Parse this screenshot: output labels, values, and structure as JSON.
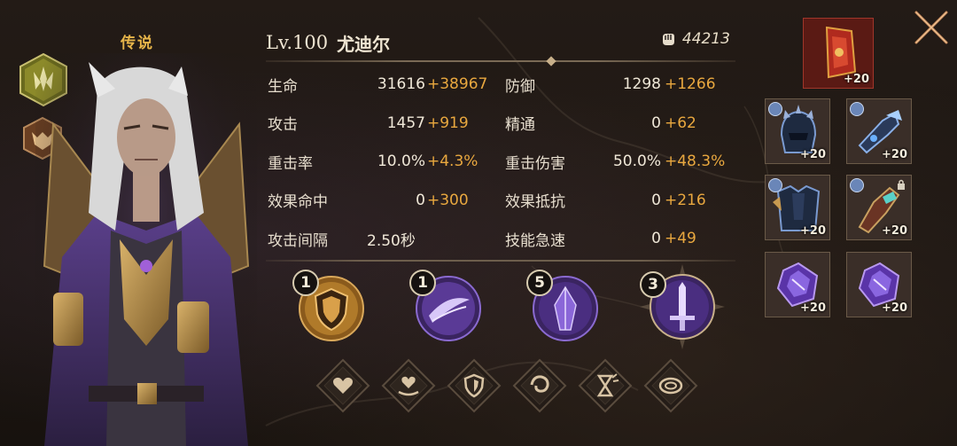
{
  "hero": {
    "rarity": "传说",
    "level": "Lv.100",
    "name": "尤迪尔",
    "power": "44213"
  },
  "stats": [
    {
      "left": {
        "name": "生命",
        "base": "31616",
        "bonus": "+38967"
      },
      "right": {
        "name": "防御",
        "base": "1298",
        "bonus": "+1266"
      }
    },
    {
      "left": {
        "name": "攻击",
        "base": "1457",
        "bonus": "+919"
      },
      "right": {
        "name": "精通",
        "base": "0",
        "bonus": "+62"
      }
    },
    {
      "left": {
        "name": "重击率",
        "base": "10.0%",
        "bonus": "+4.3%"
      },
      "right": {
        "name": "重击伤害",
        "base": "50.0%",
        "bonus": "+48.3%"
      }
    },
    {
      "left": {
        "name": "效果命中",
        "base": "0",
        "bonus": "+300"
      },
      "right": {
        "name": "效果抵抗",
        "base": "0",
        "bonus": "+216"
      }
    },
    {
      "left": {
        "name": "攻击间隔",
        "base": "2.50秒",
        "bonus": ""
      },
      "right": {
        "name": "技能急速",
        "base": "0",
        "bonus": "+49"
      }
    }
  ],
  "skills": [
    {
      "level": "1",
      "icon": "shield-skill-icon",
      "color": "#c9892e"
    },
    {
      "level": "1",
      "icon": "slash-skill-icon",
      "color": "#7a55c8"
    },
    {
      "level": "5",
      "icon": "crystal-skill-icon",
      "color": "#7a55c8"
    },
    {
      "level": "3",
      "icon": "sword-skill-icon",
      "color": "#7a55c8"
    }
  ],
  "talents": [
    {
      "icon": "heart-icon"
    },
    {
      "icon": "heart-hand-icon"
    },
    {
      "icon": "shield-icon"
    },
    {
      "icon": "swirl-icon"
    },
    {
      "icon": "hourglass-icon"
    },
    {
      "icon": "vortex-icon"
    }
  ],
  "equipment": [
    {
      "slot": "artifact",
      "icon": "relic-icon",
      "plus": "+20",
      "color": "#a02a20"
    },
    {
      "slot": "helmet",
      "icon": "helmet-icon",
      "plus": "+20",
      "color": "#2e3c5a"
    },
    {
      "slot": "weapon",
      "icon": "gauntlet-weapon-icon",
      "plus": "+20",
      "color": "#3c4c6a"
    },
    {
      "slot": "armor",
      "icon": "armor-icon",
      "plus": "+20",
      "color": "#2e3c5a"
    },
    {
      "slot": "gloves",
      "icon": "gloves-icon",
      "plus": "+20",
      "color": "#5a3a30"
    },
    {
      "slot": "gem1",
      "icon": "purple-gem-icon",
      "plus": "+20",
      "color": "#4a2c7a"
    },
    {
      "slot": "gem2",
      "icon": "purple-gem-icon",
      "plus": "+20",
      "color": "#4a2c7a"
    }
  ],
  "colors": {
    "accent": "#e9a83f",
    "rarity": "#e7b54a",
    "purple": "#7a55c8"
  }
}
